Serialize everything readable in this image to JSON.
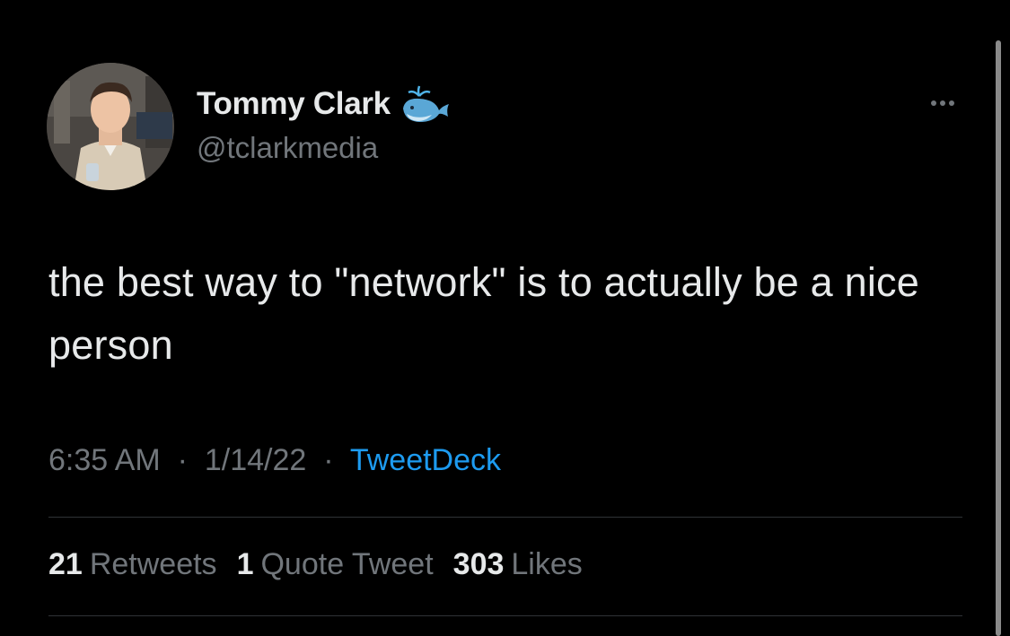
{
  "author": {
    "display_name": "Tommy Clark",
    "handle": "@tclarkmedia",
    "badge_icon": "spouting-whale-icon"
  },
  "tweet": {
    "text": "the best way to \"network\" is to actually be a nice person",
    "time": "6:35 AM",
    "date": "1/14/22",
    "separator": "·",
    "source": "TweetDeck"
  },
  "stats": {
    "retweets_count": "21",
    "retweets_label": "Retweets",
    "quotes_count": "1",
    "quotes_label": "Quote Tweet",
    "likes_count": "303",
    "likes_label": "Likes"
  },
  "colors": {
    "background": "#000000",
    "primary_text": "#e7e9ea",
    "secondary_text": "#71767b",
    "link": "#1d9bf0",
    "divider": "#2f3336"
  }
}
